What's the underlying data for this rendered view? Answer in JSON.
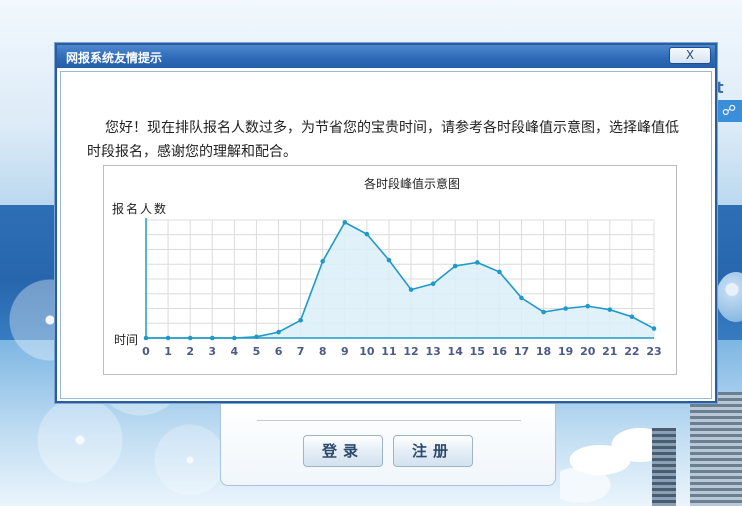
{
  "dialog": {
    "title": "网报系统友情提示",
    "close_label": "X",
    "message": "您好！现在排队报名人数过多，为节省您的宝贵时间，请参考各时段峰值示意图，选择峰值低时段报名，感谢您的理解和配合。"
  },
  "background": {
    "right_text": "t",
    "right_icon_glyph": "☍"
  },
  "login": {
    "login_label": "登录",
    "register_label": "注册"
  },
  "colors": {
    "titlebar": "#2f6bba",
    "line": "#1f9ac8",
    "fill": "#dbeff9"
  },
  "chart_data": {
    "type": "area",
    "title": "各时段峰值示意图",
    "ylabel": "报名人数",
    "xlabel": "时间",
    "x": [
      "0",
      "1",
      "2",
      "3",
      "4",
      "5",
      "6",
      "7",
      "8",
      "9",
      "10",
      "11",
      "12",
      "13",
      "14",
      "15",
      "16",
      "17",
      "18",
      "19",
      "20",
      "21",
      "22",
      "23"
    ],
    "values": [
      0,
      0,
      0,
      0,
      0,
      1,
      5,
      15,
      65,
      98,
      88,
      66,
      41,
      46,
      61,
      64,
      56,
      34,
      22,
      25,
      27,
      24,
      18,
      8
    ],
    "ylim": [
      0,
      100
    ],
    "grid": true
  }
}
